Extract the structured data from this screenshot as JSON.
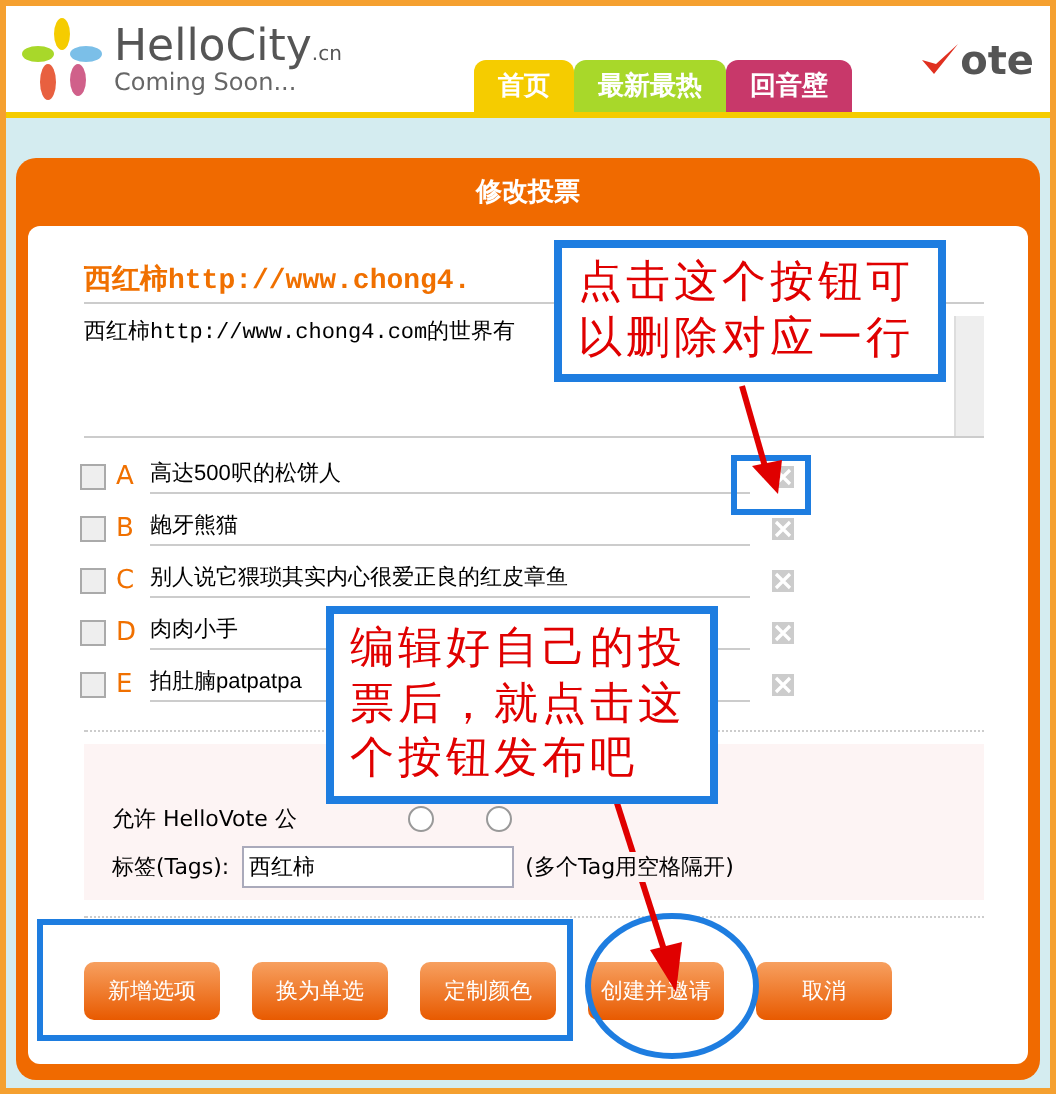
{
  "header": {
    "logo": {
      "name": "HelloCity",
      "suffix": ".cn",
      "tagline": "Coming Soon..."
    },
    "nav_tabs": [
      {
        "label": "首页",
        "color": "#f5cc00"
      },
      {
        "label": "最新最热",
        "color": "#a8d82a"
      },
      {
        "label": "回音壁",
        "color": "#c8386a"
      }
    ],
    "vote_logo": "ote"
  },
  "panel": {
    "title": "修改投票",
    "poll_title": "西红柿http://www.chong4.",
    "description": "西红柿http://www.chong4.com的世界有",
    "options": [
      {
        "letter": "A",
        "text": "高达500呎的松饼人",
        "checked": false
      },
      {
        "letter": "B",
        "text": "龅牙熊猫",
        "checked": false
      },
      {
        "letter": "C",
        "text": "别人说它猥琐其实内心很爱正良的红皮章鱼",
        "checked": false
      },
      {
        "letter": "D",
        "text": "肉肉小手",
        "checked": false
      },
      {
        "letter": "E",
        "text": "拍肚腩patpatpa",
        "checked": false
      }
    ],
    "public_label": "允许 HelloVote 公",
    "public_choices": [
      {
        "selected": false
      },
      {
        "selected": false
      }
    ],
    "tags_label": "标签(Tags):",
    "tags_value": "西红柿",
    "tags_hint": "(多个Tag用空格隔开)",
    "buttons": [
      "新增选项",
      "换为单选",
      "定制颜色",
      "创建并邀请",
      "取消"
    ]
  },
  "annotations": [
    {
      "text": "点击这个按钮可以删除对应一行"
    },
    {
      "text": "编辑好自己的投票后，就点击这个按钮发布吧"
    }
  ]
}
